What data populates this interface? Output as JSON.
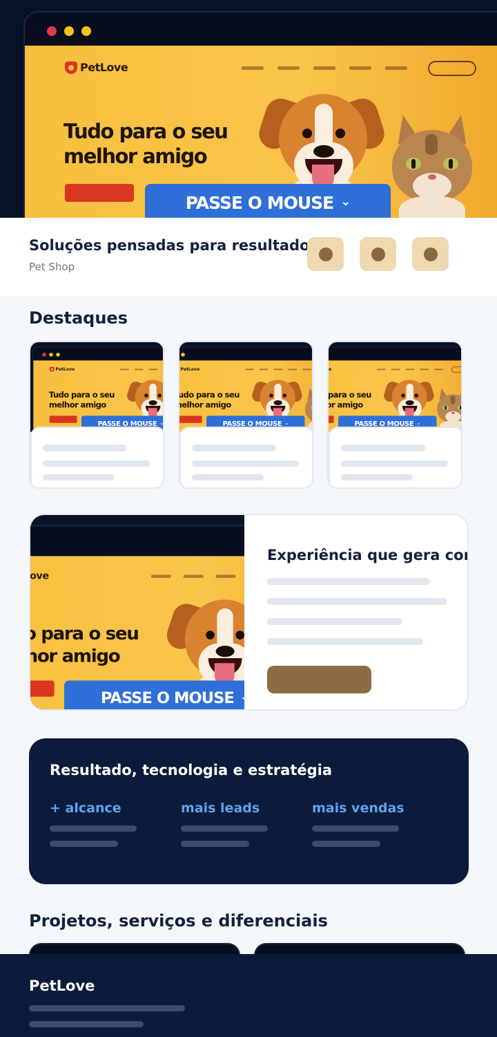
{
  "mockup": {
    "logo_text": "PetLove",
    "hero_title": "Tudo para o seu melhor amigo",
    "hover_label": "PASSE O MOUSE",
    "hover_chevron": "⌄",
    "browser_dot_colors": [
      "#e23a4a",
      "#f3c21a",
      "#f3c21a"
    ],
    "illustrations": [
      "dog",
      "cat"
    ]
  },
  "intro": {
    "title": "Soluções pensadas para resultados",
    "subtitle": "Pet Shop",
    "chips": [
      "paw-icon",
      "paw-icon",
      "paw-icon"
    ]
  },
  "highlights": {
    "heading": "Destaques",
    "cards": [
      {
        "image": "petlove-site-preview"
      },
      {
        "image": "petlove-site-preview"
      },
      {
        "image": "petlove-site-preview"
      }
    ]
  },
  "feature": {
    "title": "Experiência que gera confiança",
    "button_label": ""
  },
  "stats": {
    "title": "Resultado, tecnologia e estratégia",
    "items": [
      {
        "label": "+ alcance"
      },
      {
        "label": "mais leads"
      },
      {
        "label": "mais vendas"
      }
    ]
  },
  "projects": {
    "heading": "Projetos, serviços e diferenciais"
  },
  "footer": {
    "brand": "PetLove"
  },
  "colors": {
    "navy": "#0c1b3b",
    "accent_gold": "#8b6d42",
    "chip": "#efd9b0",
    "stat_blue": "#5fa1f0",
    "hero_yellow": "#f8bf3d",
    "cta_red": "#d9361f",
    "hover_blue": "#2f6fd8"
  }
}
